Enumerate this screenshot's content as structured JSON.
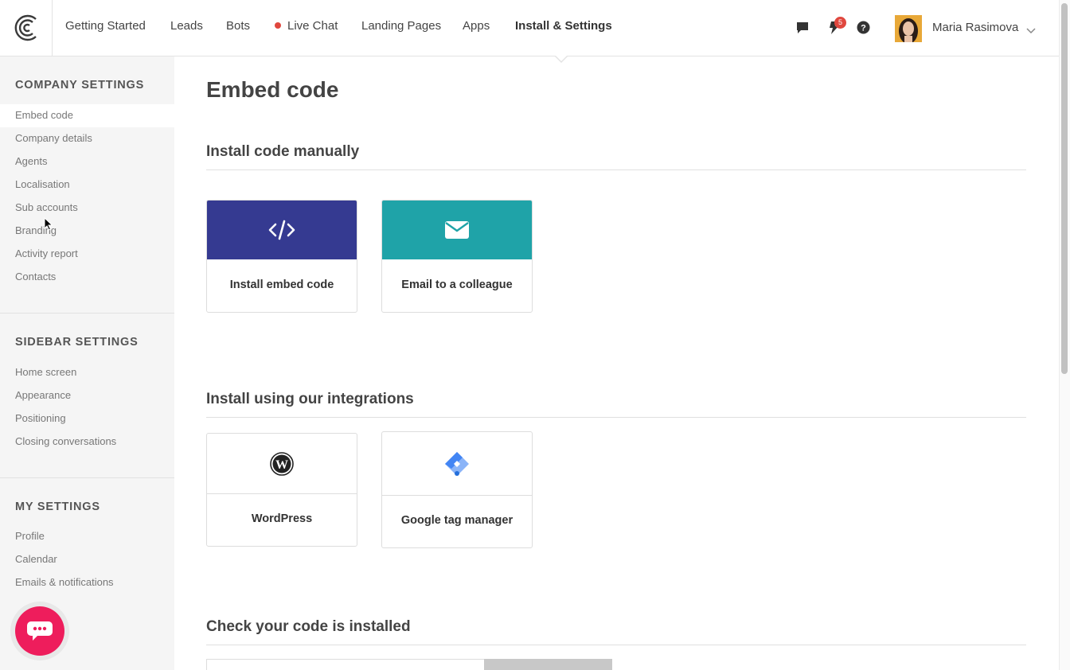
{
  "nav": {
    "items": [
      "Getting Started",
      "Leads",
      "Bots",
      "Live Chat",
      "Landing Pages",
      "Apps",
      "Install & Settings"
    ],
    "active": "Install & Settings",
    "notification_count": "5",
    "user_name": "Maria Rasimova"
  },
  "sidebar": {
    "company_title": "COMPANY SETTINGS",
    "company_items": [
      "Embed code",
      "Company details",
      "Agents",
      "Localisation",
      "Sub accounts",
      "Branding",
      "Activity report",
      "Contacts"
    ],
    "sidebar_title": "SIDEBAR SETTINGS",
    "sidebar_items": [
      "Home screen",
      "Appearance",
      "Positioning",
      "Closing conversations"
    ],
    "my_title": "MY SETTINGS",
    "my_items": [
      "Profile",
      "Calendar",
      "Emails & notifications"
    ]
  },
  "main": {
    "title": "Embed code",
    "manual_title": "Install code manually",
    "manual_cards": [
      "Install embed code",
      "Email to a colleague"
    ],
    "integrations_title": "Install using our integrations",
    "integration_cards": [
      "WordPress",
      "Google tag manager"
    ],
    "check_title": "Check your code is installed"
  },
  "colors": {
    "embed_card": "#353a91",
    "email_card": "#1fa3a8",
    "chat_bubble": "#ee1d5c",
    "badge": "#e0473e"
  }
}
